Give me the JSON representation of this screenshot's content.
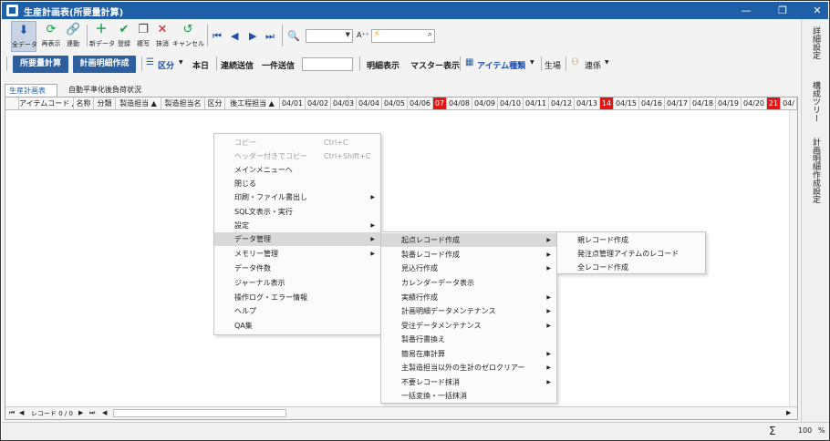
{
  "window": {
    "title": "生産計画表(所要量計算)",
    "minimize": "—",
    "restore": "❐",
    "close": "✕"
  },
  "toolbar1": {
    "all_data": "全データ",
    "reload": "再表示",
    "link": "連動",
    "new_data": "新データ",
    "register": "登録",
    "copy": "複写",
    "delete": "抹消",
    "cancel": "キャンセル",
    "font_size_label": "A⁺⁺"
  },
  "toolbar2": {
    "requirement_calc": "所要量計算",
    "plan_detail_create": "計画明細作成",
    "section": "区分",
    "today": "本日",
    "continuous_send": "連続送信",
    "single_send": "一件送信",
    "send_input": "",
    "detail_display": "明細表示",
    "master_display": "マスター表示",
    "item_type": "アイテム種類",
    "factory": "生場",
    "linkage": "連係"
  },
  "right_tabs": [
    "詳細設定",
    "構成ツリー",
    "計画明細作成設定"
  ],
  "tabs": [
    "生産計画表",
    "自動平準化後負荷状況"
  ],
  "grid": {
    "columns": [
      "アイテムコード ▲",
      "名称",
      "分類",
      "製造担当 ▲",
      "製造担当名",
      "区分",
      "後工程担当 ▲"
    ],
    "dates": [
      "04/01",
      "04/02",
      "04/03",
      "04/04",
      "04/05",
      "04/06",
      "07",
      "04/08",
      "04/09",
      "04/10",
      "04/11",
      "04/12",
      "04/13",
      "14",
      "04/15",
      "04/16",
      "04/17",
      "04/18",
      "04/19",
      "04/20",
      "21",
      "04/"
    ],
    "red_dates": [
      "07",
      "14",
      "21"
    ],
    "record_label": "レコード 0 / 0"
  },
  "status": {
    "zoom": "100",
    "percent": "%",
    "sigma": "Σ"
  },
  "context_menu": {
    "items": [
      {
        "label": "コピー",
        "shortcut": "Ctrl+C",
        "disabled": true
      },
      {
        "label": "ヘッダー付きでコピー",
        "shortcut": "Ctrl+Shift+C",
        "disabled": true
      },
      {
        "label": "メインメニューへ"
      },
      {
        "label": "閉じる"
      },
      {
        "label": "印刷・ファイル書出し",
        "submenu": true
      },
      {
        "label": "SQL文表示・実行"
      },
      {
        "label": "設定",
        "submenu": true
      },
      {
        "label": "データ管理",
        "submenu": true,
        "highlight": true
      },
      {
        "label": "メモリー管理",
        "submenu": true
      },
      {
        "label": "データ件数"
      },
      {
        "label": "ジャーナル表示"
      },
      {
        "label": "操作ログ・エラー情報"
      },
      {
        "label": "ヘルプ"
      },
      {
        "label": "QA集"
      }
    ]
  },
  "submenu1": {
    "items": [
      {
        "label": "起点レコード作成",
        "submenu": true,
        "highlight": true
      },
      {
        "label": "製番レコード作成",
        "submenu": true
      },
      {
        "label": "見込行作成",
        "submenu": true
      },
      {
        "label": "カレンダーデータ表示"
      },
      {
        "label": "実績行作成",
        "submenu": true
      },
      {
        "label": "計画明細データメンテナンス",
        "submenu": true
      },
      {
        "label": "受注データメンテナンス",
        "submenu": true
      },
      {
        "label": "製番行書換え"
      },
      {
        "label": "簡易在庫計算",
        "submenu": true
      },
      {
        "label": "主製造担当以外の生計のゼロクリアー",
        "submenu": true
      },
      {
        "label": "不要レコード抹消",
        "submenu": true
      },
      {
        "label": "一括変換・一括抹消"
      }
    ]
  },
  "submenu2": {
    "items": [
      {
        "label": "親レコード作成"
      },
      {
        "label": "発注点管理アイテムのレコード"
      },
      {
        "label": "全レコード作成"
      }
    ]
  },
  "colors": {
    "title_bar": "#1f5fa8",
    "button_blue": "#2d5f9e",
    "red_date": "#e81414"
  }
}
